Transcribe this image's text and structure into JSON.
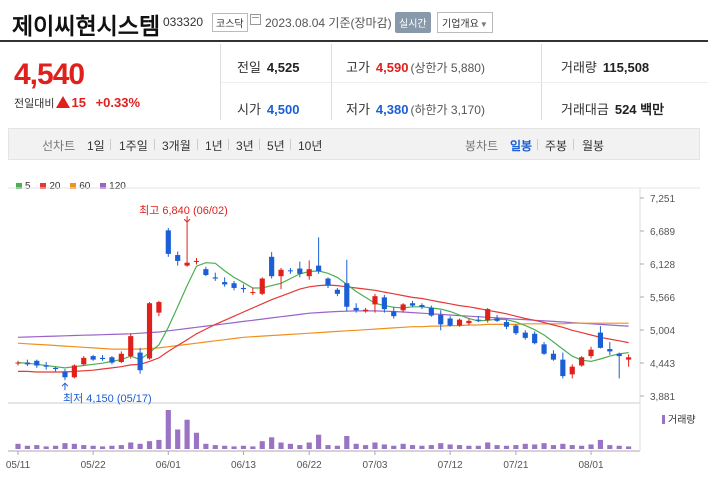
{
  "header": {
    "title": "제이씨현시스템",
    "code": "033320",
    "market": "코스닥",
    "date": "2023.08.04",
    "date_suffix": "기준(장마감)",
    "realtime_label": "실시간",
    "overview_label": "기업개요"
  },
  "price": {
    "current": "4,540",
    "change_label": "전일대비",
    "change": "15",
    "change_pct": "+0.33%"
  },
  "stats": {
    "prev_label": "전일",
    "prev": "4,525",
    "high_label": "고가",
    "high": "4,590",
    "upper_limit": "(상한가 5,880)",
    "volume_label": "거래량",
    "volume": "115,508",
    "open_label": "시가",
    "open": "4,500",
    "low_label": "저가",
    "low": "4,380",
    "lower_limit": "(하한가 3,170)",
    "value_label": "거래대금",
    "value": "524 백만"
  },
  "period_bar": {
    "line_label": "선차트",
    "line_items": [
      "1일",
      "1주일",
      "3개월",
      "1년",
      "3년",
      "5년",
      "10년"
    ],
    "candle_label": "봉차트",
    "candle_items": [
      "일봉",
      "주봉",
      "월봉"
    ],
    "active_candle": "일봉"
  },
  "colors": {
    "up": "#e0201d",
    "down": "#1a5fd6",
    "ma5": "#4caf50",
    "ma20": "#e53935",
    "ma60": "#f0901e",
    "ma120": "#9a63c8",
    "volume": "#9a73c4"
  },
  "legend": [
    {
      "label": "5",
      "color": "#4caf50"
    },
    {
      "label": "20",
      "color": "#e53935"
    },
    {
      "label": "60",
      "color": "#f0901e"
    },
    {
      "label": "120",
      "color": "#9a63c8"
    }
  ],
  "volume_label": "거래량",
  "chart_data": {
    "type": "candlestick",
    "y_ticks": [
      "7,251",
      "6,689",
      "6,128",
      "5,566",
      "5,004",
      "4,443",
      "3,881"
    ],
    "ylim": [
      3881,
      7251
    ],
    "x_ticks": [
      "05/11",
      "05/22",
      "06/01",
      "06/13",
      "06/22",
      "07/03",
      "07/12",
      "07/21",
      "08/01"
    ],
    "annotations": {
      "high": "최고 6,840 (06/02)",
      "low": "최저 4,150 (05/17)"
    },
    "candles": [
      [
        4440,
        4480,
        4400,
        4450
      ],
      [
        4450,
        4500,
        4390,
        4420
      ],
      [
        4480,
        4500,
        4360,
        4400
      ],
      [
        4400,
        4460,
        4330,
        4380
      ],
      [
        4360,
        4380,
        4300,
        4340
      ],
      [
        4300,
        4340,
        4150,
        4200
      ],
      [
        4200,
        4420,
        4180,
        4400
      ],
      [
        4420,
        4560,
        4400,
        4530
      ],
      [
        4560,
        4580,
        4480,
        4500
      ],
      [
        4530,
        4580,
        4480,
        4510
      ],
      [
        4540,
        4560,
        4420,
        4450
      ],
      [
        4460,
        4640,
        4440,
        4600
      ],
      [
        4560,
        4950,
        4520,
        4900
      ],
      [
        4620,
        4700,
        4260,
        4320
      ],
      [
        4520,
        5480,
        4500,
        5460
      ],
      [
        5300,
        5500,
        5240,
        5480
      ],
      [
        6700,
        6740,
        6250,
        6300
      ],
      [
        6280,
        6340,
        6100,
        6180
      ],
      [
        6100,
        6840,
        6080,
        6150
      ],
      [
        6180,
        6230,
        6120,
        6180
      ],
      [
        6040,
        6080,
        5920,
        5940
      ],
      [
        5900,
        5980,
        5840,
        5880
      ],
      [
        5820,
        5900,
        5740,
        5780
      ],
      [
        5800,
        5840,
        5680,
        5720
      ],
      [
        5720,
        5780,
        5640,
        5700
      ],
      [
        5640,
        5720,
        5600,
        5650
      ],
      [
        5620,
        5900,
        5600,
        5880
      ],
      [
        6250,
        6330,
        5880,
        5920
      ],
      [
        5920,
        6060,
        5700,
        6030
      ],
      [
        6020,
        6060,
        5960,
        6010
      ],
      [
        6050,
        6170,
        5900,
        5960
      ],
      [
        5920,
        6190,
        5860,
        6040
      ],
      [
        6100,
        6580,
        5960,
        6000
      ],
      [
        5880,
        5900,
        5720,
        5760
      ],
      [
        5690,
        5720,
        5580,
        5620
      ],
      [
        5800,
        6200,
        5320,
        5400
      ],
      [
        5380,
        5460,
        5300,
        5340
      ],
      [
        5320,
        5380,
        5300,
        5350
      ],
      [
        5440,
        5620,
        5300,
        5580
      ],
      [
        5560,
        5600,
        5300,
        5360
      ],
      [
        5320,
        5400,
        5200,
        5240
      ],
      [
        5340,
        5460,
        5300,
        5440
      ],
      [
        5460,
        5500,
        5400,
        5420
      ],
      [
        5430,
        5460,
        5360,
        5400
      ],
      [
        5380,
        5420,
        5230,
        5250
      ],
      [
        5260,
        5340,
        5000,
        5100
      ],
      [
        5200,
        5240,
        5060,
        5080
      ],
      [
        5080,
        5200,
        5060,
        5180
      ],
      [
        5120,
        5200,
        5080,
        5160
      ],
      [
        5180,
        5240,
        5140,
        5170
      ],
      [
        5170,
        5380,
        5130,
        5360
      ],
      [
        5200,
        5260,
        5140,
        5160
      ],
      [
        5140,
        5180,
        5020,
        5060
      ],
      [
        5080,
        5100,
        4920,
        4950
      ],
      [
        4960,
        5000,
        4840,
        4870
      ],
      [
        4940,
        4980,
        4760,
        4780
      ],
      [
        4760,
        4800,
        4580,
        4600
      ],
      [
        4600,
        4660,
        4480,
        4500
      ],
      [
        4500,
        4620,
        4180,
        4220
      ],
      [
        4250,
        4420,
        4180,
        4380
      ],
      [
        4400,
        4560,
        4380,
        4540
      ],
      [
        4560,
        4720,
        4520,
        4670
      ],
      [
        4960,
        5070,
        4690,
        4700
      ],
      [
        4680,
        4800,
        4580,
        4640
      ],
      [
        4600,
        4620,
        4180,
        4560
      ],
      [
        4500,
        4590,
        4380,
        4540
      ]
    ],
    "ma5": [
      4450,
      4440,
      4420,
      4400,
      4380,
      4360,
      4380,
      4400,
      4420,
      4440,
      4470,
      4500,
      4560,
      4500,
      4620,
      4750,
      5050,
      5400,
      5760,
      6090,
      6150,
      6140,
      6010,
      5900,
      5810,
      5720,
      5720,
      5760,
      5800,
      5880,
      5960,
      6000,
      6010,
      5970,
      5900,
      5780,
      5660,
      5560,
      5460,
      5420,
      5390,
      5380,
      5400,
      5400,
      5380,
      5360,
      5320,
      5260,
      5200,
      5160,
      5170,
      5190,
      5180,
      5140,
      5080,
      5010,
      4920,
      4800,
      4680,
      4560,
      4490,
      4470,
      4510,
      4560,
      4600,
      4620
    ],
    "ma20": [
      4300,
      4300,
      4290,
      4290,
      4290,
      4290,
      4300,
      4310,
      4320,
      4340,
      4360,
      4380,
      4410,
      4420,
      4470,
      4530,
      4640,
      4740,
      4840,
      4940,
      5020,
      5100,
      5170,
      5240,
      5310,
      5380,
      5450,
      5520,
      5580,
      5640,
      5700,
      5740,
      5760,
      5770,
      5760,
      5740,
      5720,
      5700,
      5680,
      5650,
      5620,
      5590,
      5560,
      5540,
      5510,
      5480,
      5450,
      5420,
      5400,
      5370,
      5340,
      5310,
      5280,
      5240,
      5200,
      5170,
      5130,
      5090,
      5050,
      5000,
      4960,
      4920,
      4880,
      4850,
      4820,
      4790
    ],
    "ma60": [
      4780,
      4770,
      4760,
      4750,
      4740,
      4730,
      4720,
      4710,
      4700,
      4690,
      4680,
      4680,
      4680,
      4680,
      4690,
      4700,
      4720,
      4740,
      4760,
      4780,
      4800,
      4820,
      4840,
      4860,
      4880,
      4890,
      4900,
      4910,
      4920,
      4930,
      4940,
      4950,
      4960,
      4970,
      4980,
      4990,
      5000,
      5010,
      5020,
      5030,
      5040,
      5050,
      5060,
      5060,
      5070,
      5070,
      5080,
      5080,
      5090,
      5090,
      5100,
      5100,
      5100,
      5100,
      5110,
      5110,
      5110,
      5110,
      5110,
      5120,
      5120,
      5120,
      5120,
      5120,
      5120,
      5120
    ],
    "ma120": [
      4880,
      4885,
      4890,
      4895,
      4900,
      4905,
      4910,
      4915,
      4920,
      4925,
      4930,
      4935,
      4940,
      4950,
      4960,
      4970,
      4990,
      5010,
      5030,
      5050,
      5070,
      5090,
      5110,
      5130,
      5150,
      5170,
      5190,
      5210,
      5230,
      5250,
      5270,
      5290,
      5300,
      5310,
      5320,
      5325,
      5330,
      5330,
      5330,
      5325,
      5320,
      5310,
      5300,
      5290,
      5280,
      5270,
      5260,
      5250,
      5240,
      5230,
      5220,
      5210,
      5200,
      5190,
      5180,
      5170,
      5160,
      5150,
      5140,
      5130,
      5120,
      5110,
      5100,
      5090,
      5080,
      5070
    ],
    "volume": [
      8,
      5,
      6,
      4,
      5,
      9,
      8,
      6,
      5,
      4,
      5,
      6,
      10,
      8,
      12,
      14,
      60,
      30,
      45,
      25,
      8,
      6,
      5,
      4,
      5,
      4,
      12,
      18,
      10,
      8,
      6,
      10,
      22,
      6,
      5,
      20,
      8,
      6,
      10,
      7,
      5,
      8,
      6,
      5,
      6,
      9,
      7,
      6,
      5,
      5,
      10,
      6,
      5,
      6,
      8,
      7,
      9,
      6,
      8,
      6,
      5,
      7,
      14,
      6,
      5,
      4
    ],
    "volume_max": 60
  }
}
